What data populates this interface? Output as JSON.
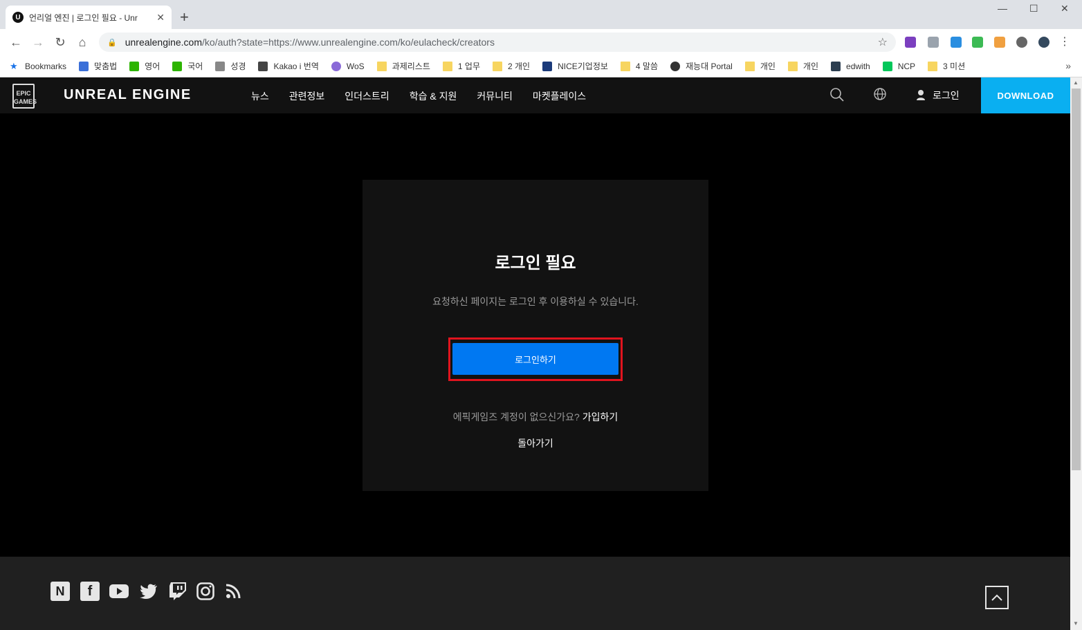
{
  "browser": {
    "tab_title": "언리얼 엔진 | 로그인 필요 - Unr",
    "tab_favicon": "U",
    "url_host": "unrealengine.com",
    "url_path": "/ko/auth?state=https://www.unrealengine.com/ko/eulacheck/creators"
  },
  "bookmarks": [
    {
      "label": "Bookmarks",
      "icon": "star"
    },
    {
      "label": "맞춤법",
      "icon": "spell"
    },
    {
      "label": "영어",
      "icon": "naver-dict"
    },
    {
      "label": "국어",
      "icon": "naver-dict"
    },
    {
      "label": "성경",
      "icon": "bible"
    },
    {
      "label": "Kakao i 번역",
      "icon": "kakao"
    },
    {
      "label": "WoS",
      "icon": "wos"
    },
    {
      "label": "과제리스트",
      "icon": "folder"
    },
    {
      "label": "1 업무",
      "icon": "folder"
    },
    {
      "label": "2 개인",
      "icon": "folder"
    },
    {
      "label": "NICE기업정보",
      "icon": "nice"
    },
    {
      "label": "4 말씀",
      "icon": "folder"
    },
    {
      "label": "재능대 Portal",
      "icon": "globe"
    },
    {
      "label": "개인",
      "icon": "folder"
    },
    {
      "label": "개인",
      "icon": "folder"
    },
    {
      "label": "edwith",
      "icon": "edwith"
    },
    {
      "label": "NCP",
      "icon": "ncp"
    },
    {
      "label": "3 미션",
      "icon": "folder"
    }
  ],
  "site": {
    "logo_text": "EPIC GAMES",
    "brand": "UNREAL ENGINE",
    "menu": [
      "뉴스",
      "관련정보",
      "인더스트리",
      "학습 & 지원",
      "커뮤니티",
      "마켓플레이스"
    ],
    "login": "로그인",
    "download": "DOWNLOAD"
  },
  "card": {
    "title": "로그인 필요",
    "message": "요청하신 페이지는 로그인 후 이용하실 수 있습니다.",
    "login_button": "로그인하기",
    "no_account": "에픽게임즈 계정이 없으신가요?",
    "signup_link": "가입하기",
    "back": "돌아가기"
  },
  "footer": {
    "social_icons": [
      "naver-icon",
      "facebook-icon",
      "youtube-icon",
      "twitter-icon",
      "twitch-icon",
      "instagram-icon",
      "rss-icon"
    ]
  }
}
